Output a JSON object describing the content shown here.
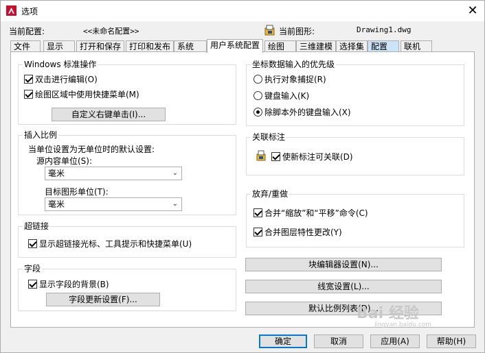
{
  "window": {
    "title": "选项"
  },
  "profile": {
    "current_profile_label": "当前配置:",
    "current_profile_value": "<<未命名配置>>",
    "current_drawing_label": "当前图形:",
    "current_drawing_value": "Drawing1.dwg"
  },
  "tabs": [
    {
      "label": "文件"
    },
    {
      "label": "显示"
    },
    {
      "label": "打开和保存"
    },
    {
      "label": "打印和发布"
    },
    {
      "label": "系统"
    },
    {
      "label": "用户系统配置"
    },
    {
      "label": "绘图"
    },
    {
      "label": "三维建模"
    },
    {
      "label": "选择集"
    },
    {
      "label": "配置"
    },
    {
      "label": "联机"
    }
  ],
  "windows_ops": {
    "title": "Windows 标准操作",
    "double_click_edit": "双击进行编辑(O)",
    "shortcut_menu": "绘图区域中使用快捷菜单(M)",
    "customize_right_click": "自定义右键单击(I)..."
  },
  "insert_scale": {
    "title": "插入比例",
    "desc": "当单位设置为无单位时的默认设置:",
    "source_label": "源内容单位(S):",
    "source_value": "毫米",
    "target_label": "目标图形单位(T):",
    "target_value": "毫米"
  },
  "hyperlink": {
    "title": "超链接",
    "display": "显示超链接光标、工具提示和快捷菜单(U)"
  },
  "fields": {
    "title": "字段",
    "display_background": "显示字段的背景(B)",
    "update_settings": "字段更新设置(F)..."
  },
  "coord_priority": {
    "title": "坐标数据输入的优先级",
    "osnap": "执行对象捕捉(R)",
    "keyboard": "键盘输入(K)",
    "keyboard_except_scripts": "除脚本外的键盘输入(X)"
  },
  "assoc_dim": {
    "title": "关联标注",
    "make_associative": "使新标注可关联(D)"
  },
  "undo_redo": {
    "title": "放弃/重做",
    "combine_zoom_pan": "合并“缩放”和“平移”命令(C)",
    "combine_layer": "合并图层特性更改(Y)"
  },
  "right_buttons": {
    "block_editor": "块编辑器设置(N)...",
    "lineweight": "线宽设置(L)...",
    "scale_list": "默认比例列表(D)..."
  },
  "footer": {
    "ok": "确定",
    "cancel": "取消",
    "apply": "应用(A)",
    "help": "帮助(H)"
  },
  "watermark": {
    "text": "Bai 经验",
    "sub": "jingyan.baidu.com"
  },
  "colors": {
    "accent": "#0078d7",
    "autocad_red": "#c8102e"
  }
}
